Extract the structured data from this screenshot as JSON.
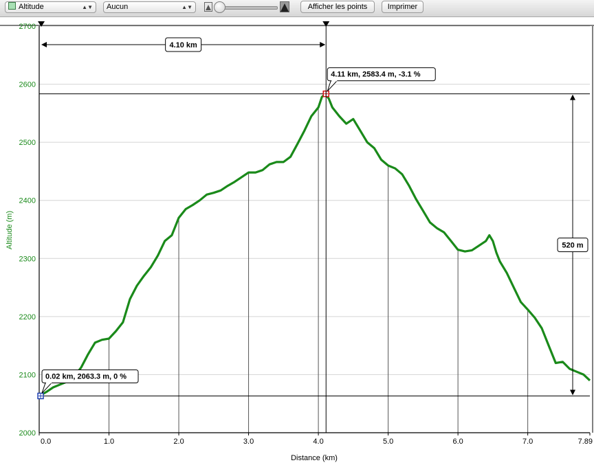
{
  "toolbar": {
    "metric_select": "Altitude",
    "overlay_select": "Aucun",
    "show_points_button": "Afficher les points",
    "print_button": "Imprimer",
    "zoom_slider": 0.0
  },
  "chart_data": {
    "type": "line",
    "xlabel": "Distance (km)",
    "ylabel": "Altitude (m)",
    "xlim": [
      0.0,
      7.89
    ],
    "ylim": [
      2000,
      2700
    ],
    "x_ticks": [
      "0.0",
      "1.0",
      "2.0",
      "3.0",
      "4.0",
      "5.0",
      "6.0",
      "7.0",
      "7.89"
    ],
    "y_ticks": [
      "2000",
      "2100",
      "2200",
      "2300",
      "2400",
      "2500",
      "2600",
      "2700"
    ],
    "grid": true,
    "color": "#1a8a1a",
    "series": [
      {
        "x": [
          0.0,
          0.1,
          0.2,
          0.3,
          0.4,
          0.5,
          0.6,
          0.7,
          0.8,
          0.9,
          1.0,
          1.1,
          1.2,
          1.3,
          1.4,
          1.5,
          1.6,
          1.7,
          1.8,
          1.9,
          2.0,
          2.1,
          2.2,
          2.3,
          2.4,
          2.5,
          2.6,
          2.7,
          2.8,
          2.9,
          3.0,
          3.1,
          3.2,
          3.3,
          3.4,
          3.5,
          3.6,
          3.7,
          3.8,
          3.9,
          4.0,
          4.05,
          4.1,
          4.15,
          4.2,
          4.3,
          4.4,
          4.5,
          4.6,
          4.7,
          4.8,
          4.9,
          5.0,
          5.1,
          5.2,
          5.3,
          5.4,
          5.5,
          5.6,
          5.7,
          5.8,
          5.9,
          6.0,
          6.1,
          6.2,
          6.3,
          6.4,
          6.45,
          6.5,
          6.55,
          6.6,
          6.7,
          6.8,
          6.9,
          7.0,
          7.1,
          7.2,
          7.3,
          7.4,
          7.5,
          7.6,
          7.7,
          7.8,
          7.89
        ],
        "y": [
          2063,
          2070,
          2078,
          2083,
          2088,
          2097,
          2112,
          2135,
          2155,
          2160,
          2162,
          2175,
          2190,
          2230,
          2253,
          2270,
          2285,
          2305,
          2330,
          2340,
          2370,
          2385,
          2392,
          2400,
          2410,
          2413,
          2417,
          2425,
          2432,
          2440,
          2448,
          2448,
          2452,
          2462,
          2466,
          2466,
          2475,
          2497,
          2520,
          2545,
          2560,
          2578,
          2583,
          2575,
          2560,
          2545,
          2532,
          2540,
          2520,
          2500,
          2490,
          2470,
          2460,
          2455,
          2445,
          2425,
          2402,
          2382,
          2362,
          2352,
          2345,
          2330,
          2315,
          2312,
          2314,
          2322,
          2330,
          2340,
          2330,
          2310,
          2295,
          2275,
          2250,
          2225,
          2212,
          2198,
          2180,
          2150,
          2120,
          2122,
          2110,
          2105,
          2100,
          2090
        ]
      }
    ],
    "markers": [
      {
        "x": 0.02,
        "y": 2063.3,
        "label": "0.02 km, 2063.3 m, 0 %",
        "color": "#2040b0"
      },
      {
        "x": 4.11,
        "y": 2583.4,
        "label": "4.11 km, 2583.4 m, -3.1 %",
        "color": "#d01010"
      }
    ],
    "distance_measure": {
      "label": "4.10 km",
      "from": 0.02,
      "to": 4.11
    },
    "altitude_measure": {
      "label": "520 m",
      "from": 2063.3,
      "to": 2583.4
    }
  }
}
